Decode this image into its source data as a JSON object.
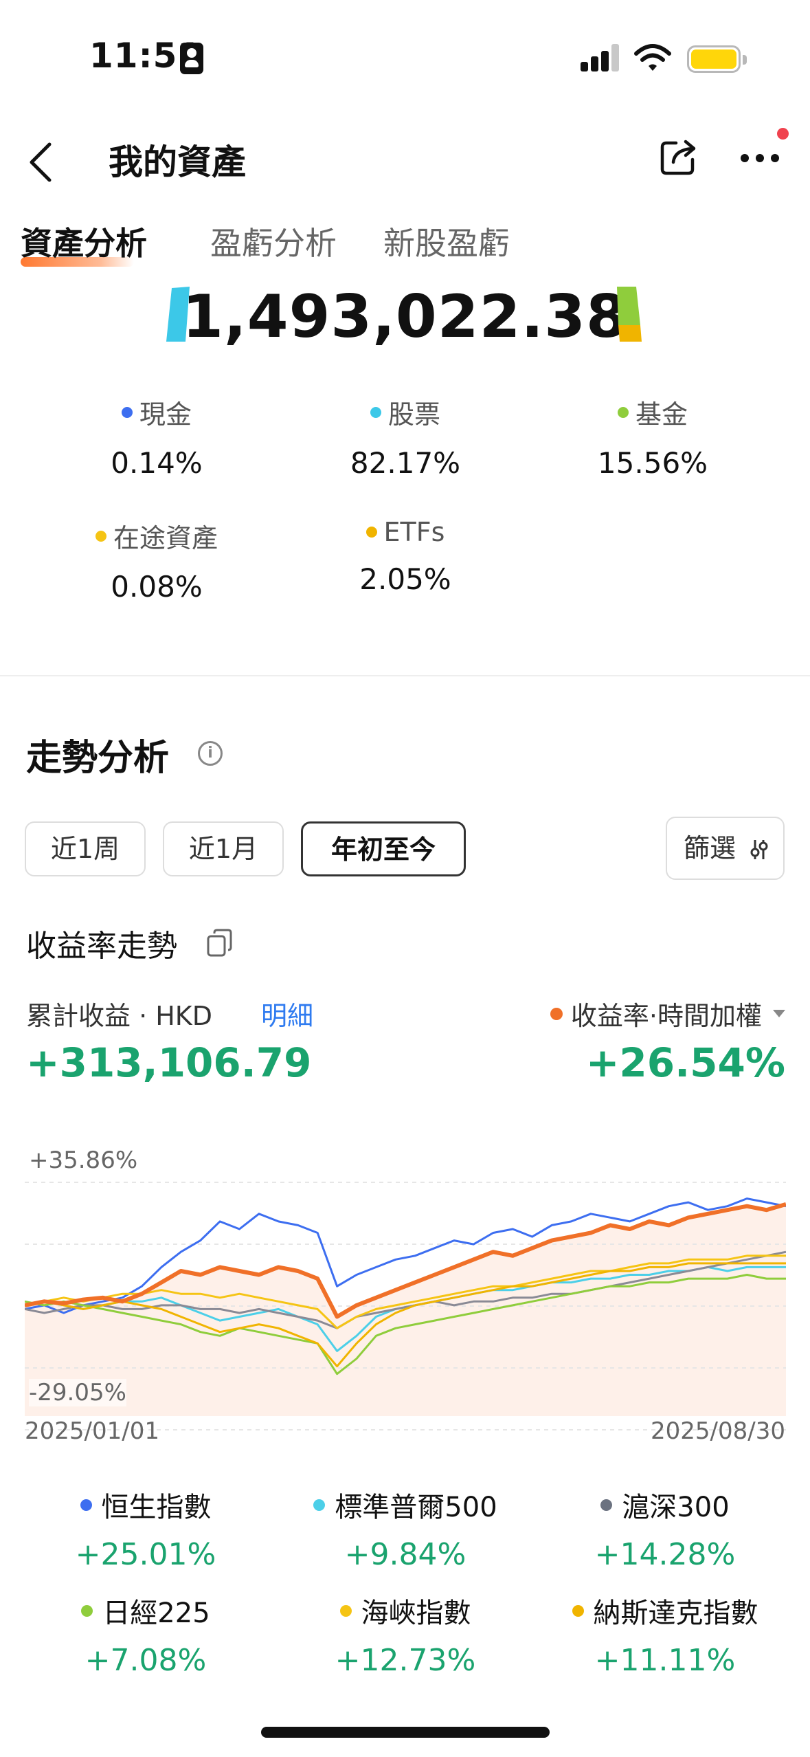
{
  "status_bar": {
    "time": "11:51"
  },
  "nav": {
    "title": "我的資產"
  },
  "tabs": [
    {
      "label": "資產分析",
      "active": true
    },
    {
      "label": "盈虧分析",
      "active": false
    },
    {
      "label": "新股盈虧",
      "active": false
    }
  ],
  "total_assets": "1,493,022.38",
  "allocation": [
    {
      "label": "現金",
      "value": "0.14%",
      "color": "#3d6ef0"
    },
    {
      "label": "股票",
      "value": "82.17%",
      "color": "#3cc8e8"
    },
    {
      "label": "基金",
      "value": "15.56%",
      "color": "#8fcd3c"
    },
    {
      "label": "在途資產",
      "value": "0.08%",
      "color": "#f5c414"
    },
    {
      "label": "ETFs",
      "value": "2.05%",
      "color": "#f0b400"
    }
  ],
  "trend": {
    "title": "走勢分析",
    "info_icon": "info-icon",
    "periods": [
      {
        "label": "近1周",
        "active": false
      },
      {
        "label": "近1月",
        "active": false
      },
      {
        "label": "年初至今",
        "active": true
      }
    ],
    "filter_label": "篩選",
    "subtitle": "收益率走勢",
    "cumulative_label": "累計收益 · HKD",
    "detail_label": "明細",
    "rate_label": "收益率·時間加權",
    "cumulative_value": "+313,106.79",
    "rate_value": "+26.54%"
  },
  "chart_data": {
    "type": "line",
    "ylim_labels": {
      "top": "+35.86%",
      "bottom": "-29.05%"
    },
    "ylim": [
      -29.05,
      35.86
    ],
    "x_start": "2025/01/01",
    "x_end": "2025/08/30",
    "grid": true,
    "series": [
      {
        "name": "收益率·時間加權",
        "color": "#f07028",
        "final": 26.54,
        "values": [
          0,
          1,
          0.5,
          1.5,
          2,
          1,
          3,
          6,
          9,
          8,
          10,
          9,
          8,
          10,
          9,
          7,
          -3,
          0,
          2,
          4,
          6,
          8,
          10,
          12,
          14,
          13,
          15,
          17,
          18,
          19,
          21,
          20,
          22,
          21,
          23,
          24,
          25,
          26,
          25,
          26.5
        ]
      },
      {
        "name": "恒生指數",
        "color": "#3d6ef0",
        "final": 25.01,
        "values": [
          -1,
          0,
          -2,
          0,
          1,
          2,
          5,
          10,
          14,
          17,
          22,
          20,
          24,
          22,
          21,
          19,
          5,
          8,
          10,
          12,
          13,
          15,
          17,
          16,
          19,
          20,
          18,
          21,
          22,
          24,
          23,
          22,
          24,
          26,
          27,
          25,
          26,
          28,
          27,
          26
        ]
      },
      {
        "name": "標準普爾500",
        "color": "#4ccfe8",
        "final": 9.84,
        "values": [
          0,
          1,
          0,
          -1,
          0,
          1,
          1,
          2,
          0,
          -2,
          -4,
          -3,
          -2,
          -1,
          -3,
          -5,
          -12,
          -8,
          -3,
          -1,
          0,
          1,
          2,
          3,
          4,
          4,
          5,
          6,
          6,
          7,
          7,
          8,
          8,
          9,
          9,
          10,
          9,
          10,
          10,
          10
        ]
      },
      {
        "name": "滬深300",
        "color": "#8a8a95",
        "final": 14.28,
        "values": [
          -1,
          -2,
          -1,
          0,
          0,
          -1,
          -1,
          0,
          0,
          -1,
          -1,
          -2,
          -1,
          -2,
          -3,
          -4,
          -6,
          -3,
          -2,
          -1,
          0,
          1,
          0,
          1,
          1,
          2,
          2,
          3,
          3,
          4,
          5,
          6,
          7,
          8,
          9,
          10,
          11,
          12,
          13,
          14
        ]
      },
      {
        "name": "日經225",
        "color": "#8fcd3c",
        "final": 7.08,
        "values": [
          1,
          0,
          1,
          0,
          -1,
          -2,
          -3,
          -4,
          -5,
          -7,
          -8,
          -6,
          -7,
          -8,
          -9,
          -10,
          -18,
          -14,
          -8,
          -6,
          -5,
          -4,
          -3,
          -2,
          -1,
          0,
          1,
          2,
          3,
          4,
          5,
          5,
          6,
          6,
          7,
          7,
          7,
          8,
          7,
          7
        ]
      },
      {
        "name": "海峽指數",
        "color": "#f5c414",
        "final": 12.73,
        "values": [
          0,
          1,
          2,
          1,
          2,
          3,
          3,
          4,
          3,
          3,
          2,
          3,
          2,
          1,
          0,
          -1,
          -6,
          -3,
          -1,
          0,
          1,
          2,
          3,
          4,
          5,
          5,
          6,
          7,
          8,
          9,
          9,
          10,
          11,
          11,
          12,
          12,
          12,
          13,
          13,
          13
        ]
      },
      {
        "name": "納斯達克指數",
        "color": "#f0b400",
        "final": 11.11,
        "values": [
          0,
          1,
          0,
          -1,
          0,
          1,
          0,
          -1,
          -3,
          -5,
          -7,
          -6,
          -5,
          -6,
          -8,
          -10,
          -16,
          -10,
          -5,
          -2,
          0,
          1,
          2,
          3,
          4,
          5,
          5,
          6,
          7,
          8,
          9,
          9,
          10,
          10,
          11,
          11,
          11,
          11,
          11,
          11
        ]
      }
    ]
  },
  "indices": [
    {
      "name": "恒生指數",
      "value": "+25.01%",
      "color": "#3d6ef0"
    },
    {
      "name": "標準普爾500",
      "value": "+9.84%",
      "color": "#4ccfe8"
    },
    {
      "name": "滬深300",
      "value": "+14.28%",
      "color": "#6b7280"
    },
    {
      "name": "日經225",
      "value": "+7.08%",
      "color": "#8fcd3c"
    },
    {
      "name": "海峽指數",
      "value": "+12.73%",
      "color": "#f5c414"
    },
    {
      "name": "納斯達克指數",
      "value": "+11.11%",
      "color": "#f0b400"
    }
  ]
}
